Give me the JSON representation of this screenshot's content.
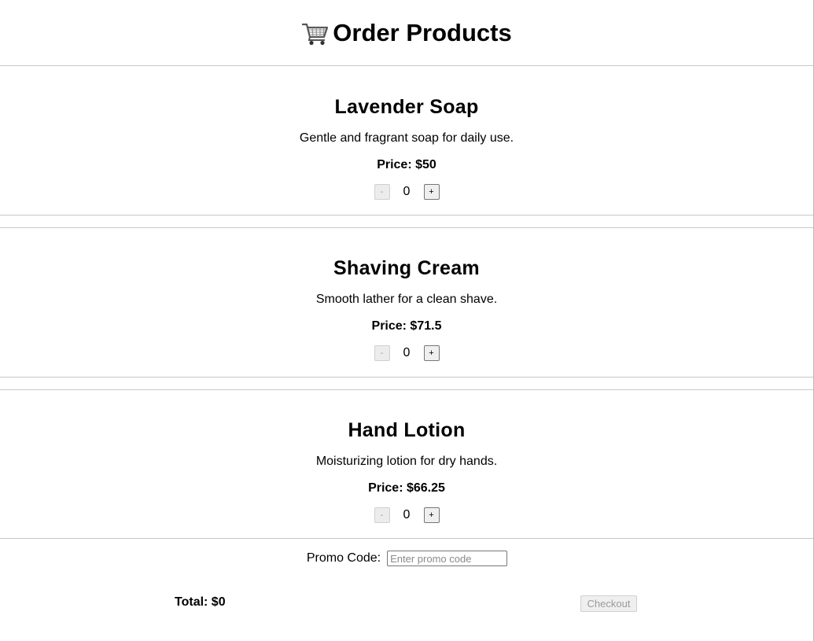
{
  "header": {
    "icon": "shopping-cart-icon",
    "title": "Order Products"
  },
  "products": [
    {
      "name": "Lavender Soap",
      "description": "Gentle and fragrant soap for daily use.",
      "price_text": "Price: $50",
      "quantity": "0",
      "minus_label": "-",
      "plus_label": "+"
    },
    {
      "name": "Shaving Cream",
      "description": "Smooth lather for a clean shave.",
      "price_text": "Price: $71.5",
      "quantity": "0",
      "minus_label": "-",
      "plus_label": "+"
    },
    {
      "name": "Hand Lotion",
      "description": "Moisturizing lotion for dry hands.",
      "price_text": "Price: $66.25",
      "quantity": "0",
      "minus_label": "-",
      "plus_label": "+"
    }
  ],
  "promo": {
    "label": "Promo Code:",
    "value": "",
    "placeholder": "Enter promo code"
  },
  "footer": {
    "total_text": "Total: $0",
    "checkout_label": "Checkout"
  }
}
